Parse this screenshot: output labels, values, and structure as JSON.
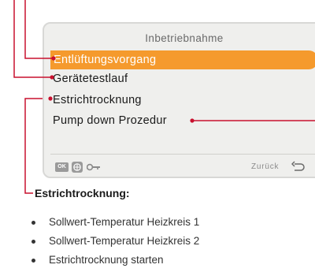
{
  "screen": {
    "title": "Inbetriebnahme",
    "menu_items": [
      {
        "label": "Entlüftungsvorgang",
        "selected": true
      },
      {
        "label": "Gerätetestlauf",
        "selected": false
      },
      {
        "label": "Estrichtrocknung",
        "selected": false
      },
      {
        "label": "Pump down Prozedur",
        "selected": false
      }
    ],
    "buttons": {
      "ok_label": "OK",
      "back_label": "Zurück"
    },
    "icons": {
      "ok": "ok-key-icon",
      "menu": "menu-key-icon",
      "service": "wrench-icon",
      "back": "back-arrow-icon"
    }
  },
  "description": {
    "heading": "Estrichtrocknung:",
    "items": [
      "Sollwert-Temperatur Heizkreis 1",
      "Sollwert-Temperatur Heizkreis 2",
      "Estrichtrocknung starten"
    ]
  },
  "colors": {
    "selection": "#f59a2d",
    "callout": "#c8102e",
    "screen_background": "#efefed"
  }
}
